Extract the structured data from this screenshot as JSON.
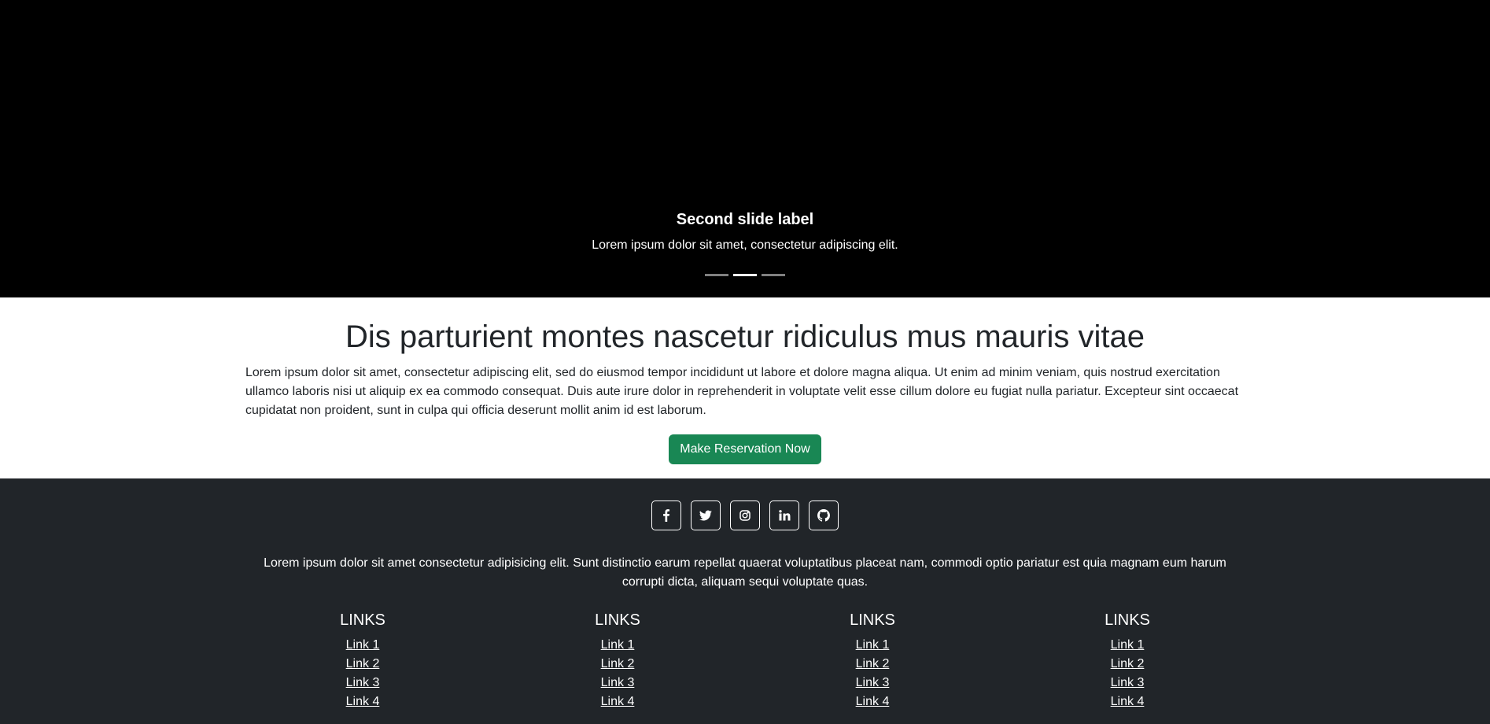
{
  "carousel": {
    "caption_title": "Second slide label",
    "caption_text": "Lorem ipsum dolor sit amet, consectetur adipiscing elit.",
    "indicator_count": 3,
    "active_indicator": 2
  },
  "main": {
    "heading": "Dis parturient montes nascetur ridiculus mus mauris vitae",
    "body": "Lorem ipsum dolor sit amet, consectetur adipiscing elit, sed do eiusmod tempor incididunt ut labore et dolore magna aliqua. Ut enim ad minim veniam, quis nostrud exercitation ullamco laboris nisi ut aliquip ex ea commodo consequat. Duis aute irure dolor in reprehenderit in voluptate velit esse cillum dolore eu fugiat nulla pariatur. Excepteur sint occaecat cupidatat non proident, sunt in culpa qui officia deserunt mollit anim id est laborum.",
    "button_label": "Make Reservation Now",
    "button_color": "#198754"
  },
  "footer": {
    "background": "#212529",
    "social_icons": [
      "facebook-icon",
      "twitter-icon",
      "instagram-icon",
      "linkedin-icon",
      "github-icon"
    ],
    "text": "Lorem ipsum dolor sit amet consectetur adipisicing elit. Sunt distinctio earum repellat quaerat voluptatibus placeat nam, commodi optio pariatur est quia magnam eum harum corrupti dicta, aliquam sequi voluptate quas.",
    "columns": [
      {
        "title": "LINKS",
        "links": [
          "Link 1",
          "Link 2",
          "Link 3",
          "Link 4"
        ]
      },
      {
        "title": "LINKS",
        "links": [
          "Link 1",
          "Link 2",
          "Link 3",
          "Link 4"
        ]
      },
      {
        "title": "LINKS",
        "links": [
          "Link 1",
          "Link 2",
          "Link 3",
          "Link 4"
        ]
      },
      {
        "title": "LINKS",
        "links": [
          "Link 1",
          "Link 2",
          "Link 3",
          "Link 4"
        ]
      }
    ]
  }
}
